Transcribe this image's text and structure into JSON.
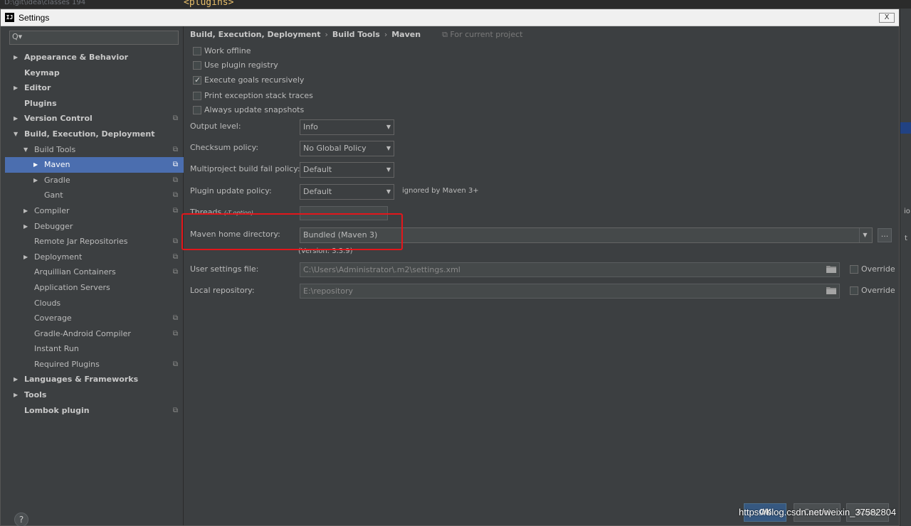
{
  "background": {
    "line_number": "194",
    "editor_text": "<plugins>",
    "left_text": "D:\\git\\idea\\classes",
    "right_fragments": [
      "io",
      "t"
    ]
  },
  "window": {
    "title": "Settings",
    "close_label": "X"
  },
  "sidebar": {
    "search_icon": "Q▾",
    "items": [
      {
        "label": "Appearance & Behavior",
        "level": 0,
        "arrow": "▶",
        "bold": true,
        "project": false
      },
      {
        "label": "Keymap",
        "level": 0,
        "arrow": "",
        "bold": true,
        "project": false
      },
      {
        "label": "Editor",
        "level": 0,
        "arrow": "▶",
        "bold": true,
        "project": false
      },
      {
        "label": "Plugins",
        "level": 0,
        "arrow": "",
        "bold": true,
        "project": false
      },
      {
        "label": "Version Control",
        "level": 0,
        "arrow": "▶",
        "bold": true,
        "project": true
      },
      {
        "label": "Build, Execution, Deployment",
        "level": 0,
        "arrow": "▼",
        "bold": true,
        "project": false
      },
      {
        "label": "Build Tools",
        "level": 1,
        "arrow": "▼",
        "bold": false,
        "project": true
      },
      {
        "label": "Maven",
        "level": 2,
        "arrow": "▶",
        "bold": false,
        "project": true,
        "selected": true
      },
      {
        "label": "Gradle",
        "level": 2,
        "arrow": "▶",
        "bold": false,
        "project": true
      },
      {
        "label": "Gant",
        "level": 2,
        "arrow": "",
        "bold": false,
        "project": true
      },
      {
        "label": "Compiler",
        "level": 1,
        "arrow": "▶",
        "bold": false,
        "project": true
      },
      {
        "label": "Debugger",
        "level": 1,
        "arrow": "▶",
        "bold": false,
        "project": false
      },
      {
        "label": "Remote Jar Repositories",
        "level": 1,
        "arrow": "",
        "bold": false,
        "project": true
      },
      {
        "label": "Deployment",
        "level": 1,
        "arrow": "▶",
        "bold": false,
        "project": true
      },
      {
        "label": "Arquillian Containers",
        "level": 1,
        "arrow": "",
        "bold": false,
        "project": true
      },
      {
        "label": "Application Servers",
        "level": 1,
        "arrow": "",
        "bold": false,
        "project": false
      },
      {
        "label": "Clouds",
        "level": 1,
        "arrow": "",
        "bold": false,
        "project": false
      },
      {
        "label": "Coverage",
        "level": 1,
        "arrow": "",
        "bold": false,
        "project": true
      },
      {
        "label": "Gradle-Android Compiler",
        "level": 1,
        "arrow": "",
        "bold": false,
        "project": true
      },
      {
        "label": "Instant Run",
        "level": 1,
        "arrow": "",
        "bold": false,
        "project": false
      },
      {
        "label": "Required Plugins",
        "level": 1,
        "arrow": "",
        "bold": false,
        "project": true
      },
      {
        "label": "Languages & Frameworks",
        "level": 0,
        "arrow": "▶",
        "bold": true,
        "project": false
      },
      {
        "label": "Tools",
        "level": 0,
        "arrow": "▶",
        "bold": true,
        "project": false
      },
      {
        "label": "Lombok plugin",
        "level": 0,
        "arrow": "",
        "bold": true,
        "project": true
      }
    ],
    "help_label": "?"
  },
  "breadcrumb": {
    "parts": [
      "Build, Execution, Deployment",
      "Build Tools",
      "Maven"
    ],
    "separator": "›",
    "project_note": "⧉ For current project"
  },
  "checkboxes": [
    {
      "label": "Work offline",
      "checked": false
    },
    {
      "label": "Use plugin registry",
      "checked": false
    },
    {
      "label": "Execute goals recursively",
      "checked": true
    },
    {
      "label": "Print exception stack traces",
      "checked": false
    },
    {
      "label": "Always update snapshots",
      "checked": false
    }
  ],
  "fields": {
    "output_level": {
      "label": "Output level:",
      "value": "Info"
    },
    "checksum_policy": {
      "label": "Checksum policy:",
      "value": "No Global Policy"
    },
    "multiproject_fail": {
      "label": "Multiproject build fail policy:",
      "value": "Default"
    },
    "plugin_update": {
      "label": "Plugin update policy:",
      "value": "Default",
      "hint": "ignored by Maven 3+"
    },
    "threads": {
      "label": "Threads",
      "option": "(-T option)",
      "value": ""
    },
    "maven_home": {
      "label": "Maven home directory:",
      "value": "Bundled (Maven 3)",
      "version": "(Version: 3.3.9)",
      "more": "..."
    },
    "user_settings": {
      "label": "User settings file:",
      "value": "C:\\Users\\Administrator\\.m2\\settings.xml",
      "override": "Override",
      "override_checked": false
    },
    "local_repo": {
      "label": "Local repository:",
      "value": "E:\\repository",
      "override": "Override",
      "override_checked": false
    }
  },
  "footer": {
    "ok": "OK",
    "cancel": "Cancel",
    "apply": "Apply",
    "watermark": "https://blog.csdn.net/weixin_37582804"
  },
  "colors": {
    "selection": "#4b6eaf",
    "highlight_box": "#e3161b",
    "primary_button": "#365880"
  }
}
